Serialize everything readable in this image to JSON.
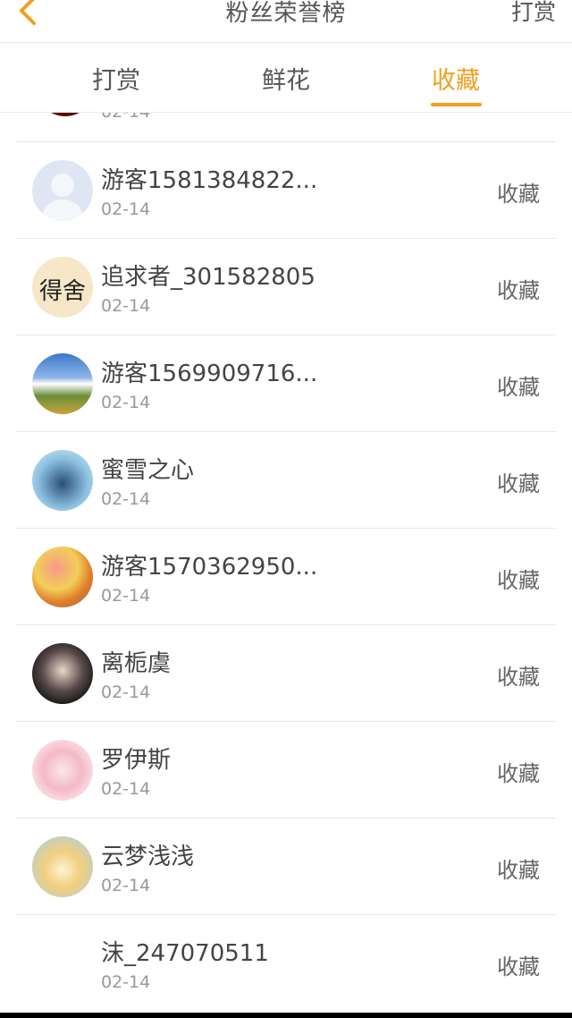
{
  "header": {
    "title": "粉丝荣誉榜",
    "action": "打赏"
  },
  "tabs": [
    {
      "label": "打赏"
    },
    {
      "label": "鲜花"
    },
    {
      "label": "收藏"
    }
  ],
  "partial_row": {
    "date": "02-14"
  },
  "rows": [
    {
      "name": "游客1581384822...",
      "date": "02-14",
      "tag": "收藏"
    },
    {
      "name": "追求者_301582805",
      "date": "02-14",
      "tag": "收藏"
    },
    {
      "name": "游客1569909716...",
      "date": "02-14",
      "tag": "收藏"
    },
    {
      "name": "蜜雪之心",
      "date": "02-14",
      "tag": "收藏"
    },
    {
      "name": "游客1570362950...",
      "date": "02-14",
      "tag": "收藏"
    },
    {
      "name": "离栀虞",
      "date": "02-14",
      "tag": "收藏"
    },
    {
      "name": "罗伊斯",
      "date": "02-14",
      "tag": "收藏"
    },
    {
      "name": "云梦浅浅",
      "date": "02-14",
      "tag": "收藏"
    },
    {
      "name": "沫_247070511",
      "date": "02-14",
      "tag": "收藏"
    }
  ],
  "avatar_text": "得舍",
  "colors": {
    "accent": "#f0a020",
    "divider": "#e8e8e8"
  }
}
